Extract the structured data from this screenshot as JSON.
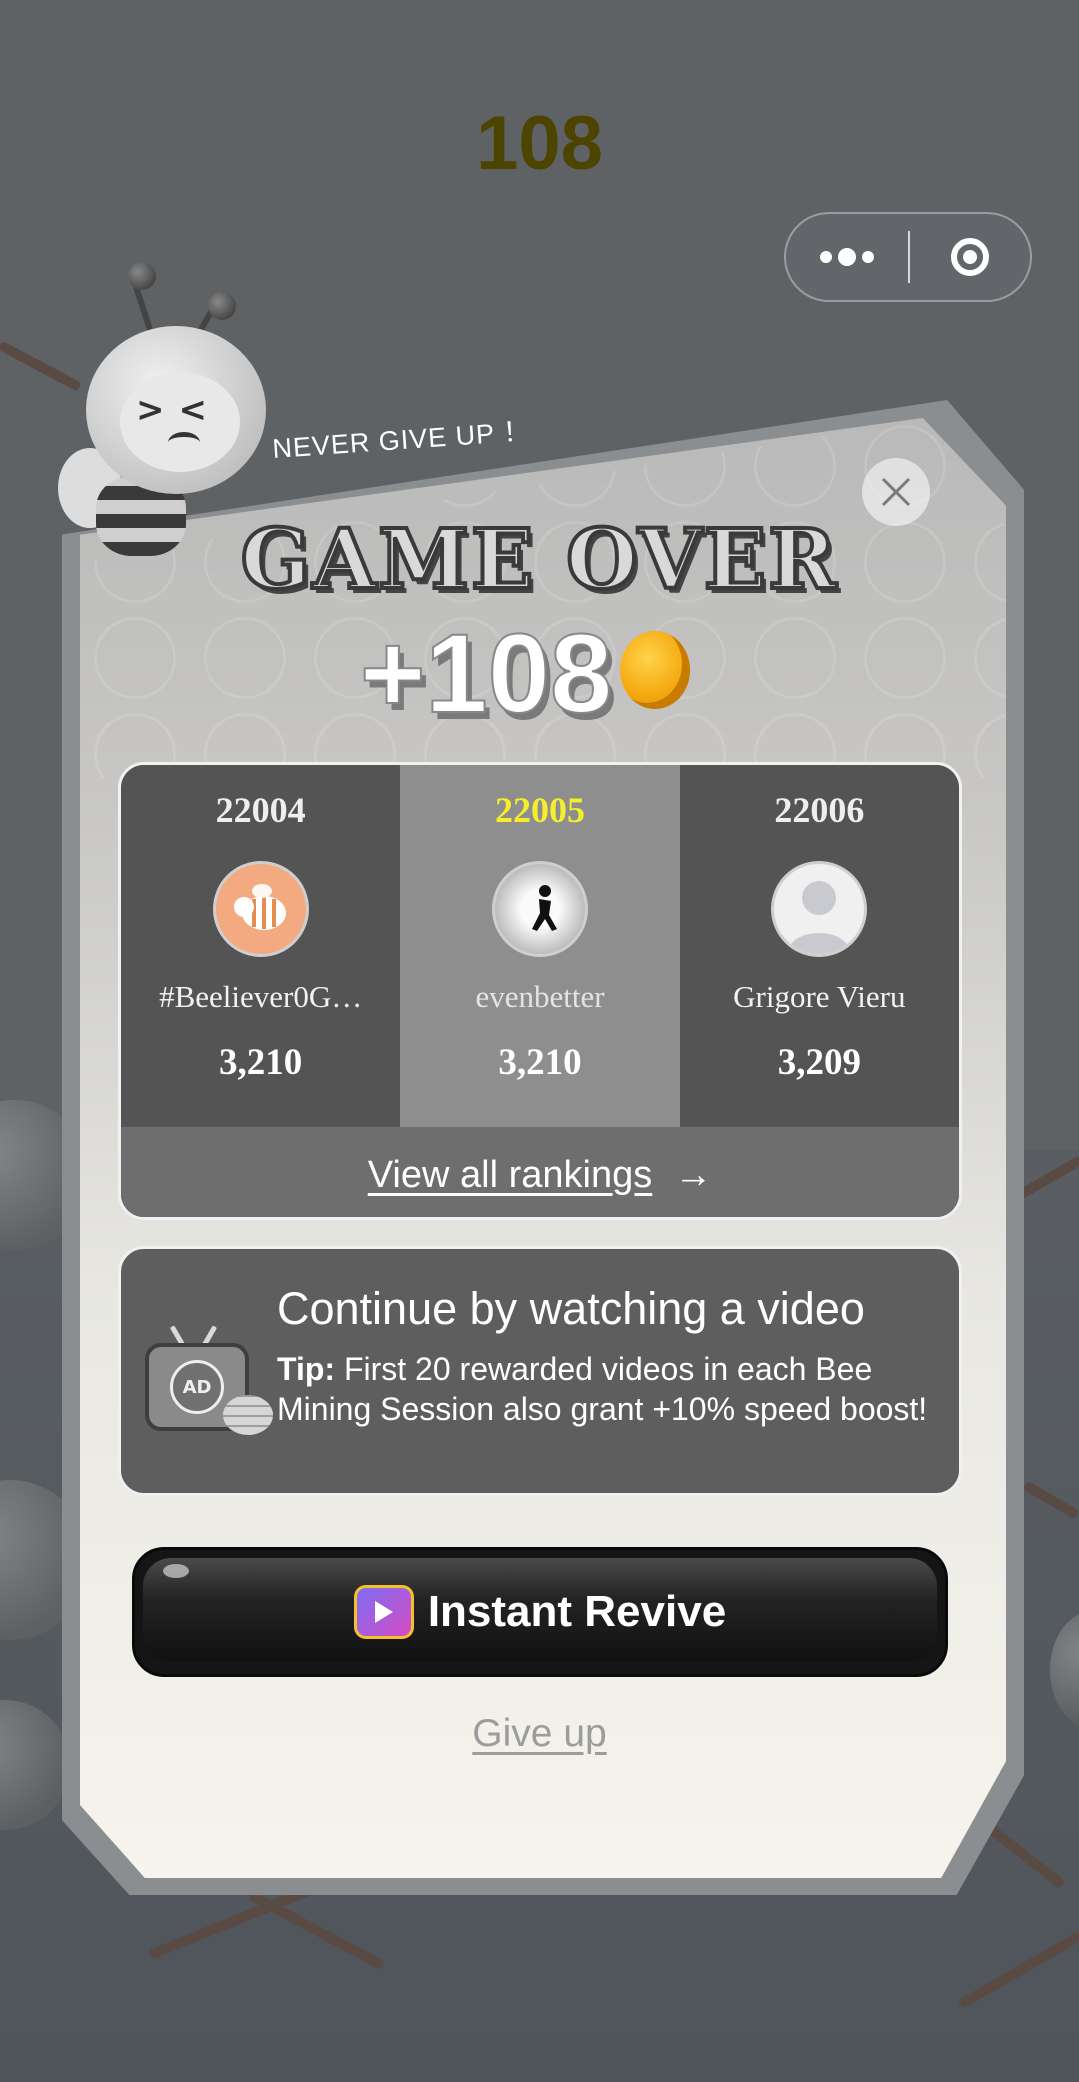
{
  "hud": {
    "score": "108"
  },
  "capsule": {
    "more_icon": "more-dots-icon",
    "close_icon": "target-close-icon"
  },
  "panel": {
    "tagline": "NEVER GIVE UP ！",
    "title": "GAME OVER",
    "reward": "+108",
    "reward_icon": "gold-coin-icon",
    "close_icon": "close-icon"
  },
  "leaderboard": {
    "entries": [
      {
        "rank": "22004",
        "name": "#Beeliever0G…",
        "score": "3,210",
        "avatar": "bee-avatar",
        "current": false
      },
      {
        "rank": "22005",
        "name": "evenbetter",
        "score": "3,210",
        "avatar": "photo-avatar",
        "current": true
      },
      {
        "rank": "22006",
        "name": "Grigore Vieru",
        "score": "3,209",
        "avatar": "default-user-avatar",
        "current": false
      }
    ],
    "view_all": "View all rankings",
    "view_all_icon": "arrow-right-icon"
  },
  "continue": {
    "title": "Continue by watching a video",
    "tip_label": "Tip:",
    "tip_text": " First 20 rewarded videos in each Bee Mining Session also grant +10% speed boost!",
    "icon": "ad-tv-icon",
    "badge": "AD"
  },
  "revive": {
    "label": "Instant Revive",
    "icon": "video-tv-icon"
  },
  "give_up": "Give up",
  "colors": {
    "current_rank": "#f5ee2a",
    "coin": "#f4a60e",
    "revive_button": "#151515"
  }
}
